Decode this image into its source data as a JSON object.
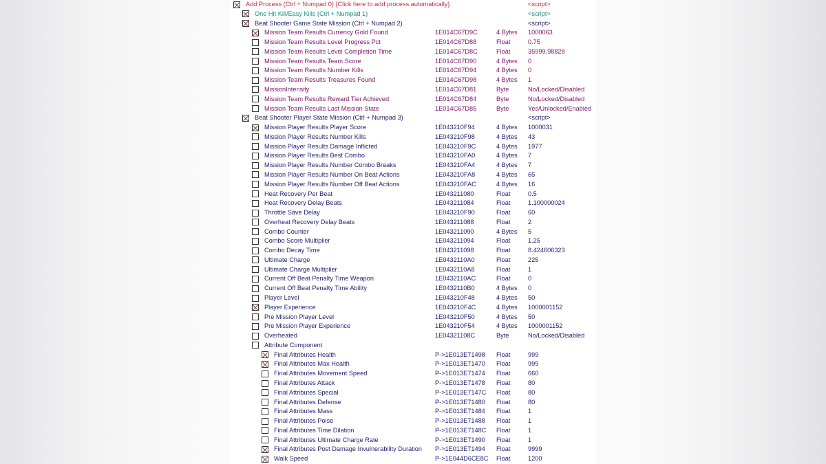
{
  "colors": {
    "red": "#c8283c",
    "teal": "#1f8c84",
    "navy": "#1e1e64",
    "purple": "#7a1468",
    "blue": "#23236e"
  },
  "rows": [
    {
      "level": 0,
      "checked": true,
      "color": "red",
      "desc": "Add Process (Ctrl + Numpad 0) {Click here to add process automatically}",
      "address": "",
      "type": "",
      "value": "<script>"
    },
    {
      "level": 1,
      "checked": true,
      "color": "teal",
      "desc": "One Hit Kill/Easy Kills (Ctrl + Numpad 1)",
      "address": "",
      "type": "",
      "value": "<script>"
    },
    {
      "level": 1,
      "checked": true,
      "color": "navy",
      "desc": "Beat Shooter Game State Mission (Ctrl + Numpad 2)",
      "address": "",
      "type": "",
      "value": "<script>"
    },
    {
      "level": 2,
      "checked": true,
      "color": "purple",
      "desc": "Mission Team Results Currency Gold Found",
      "address": "1E014C67D9C",
      "type": "4 Bytes",
      "value": "1000063"
    },
    {
      "level": 2,
      "checked": false,
      "color": "purple",
      "desc": "Mission Team Results Level Progress Pct",
      "address": "1E014C67D88",
      "type": "Float",
      "value": "0.75"
    },
    {
      "level": 2,
      "checked": false,
      "color": "purple",
      "desc": "Mission Team Results Level Completion Time",
      "address": "1E014C67D8C",
      "type": "Float",
      "value": "35999.98828"
    },
    {
      "level": 2,
      "checked": false,
      "color": "purple",
      "desc": "Mission Team Results Team Score",
      "address": "1E014C67D90",
      "type": "4 Bytes",
      "value": "0"
    },
    {
      "level": 2,
      "checked": false,
      "color": "purple",
      "desc": "Mission Team Results Number Kills",
      "address": "1E014C67D94",
      "type": "4 Bytes",
      "value": "0"
    },
    {
      "level": 2,
      "checked": false,
      "color": "purple",
      "desc": "Mission Team Results Treasures Found",
      "address": "1E014C67D98",
      "type": "4 Bytes",
      "value": "1"
    },
    {
      "level": 2,
      "checked": false,
      "color": "purple",
      "desc": "MissionIntensity",
      "address": "1E014C67D81",
      "type": "Byte",
      "value": "No/Locked/Disabled"
    },
    {
      "level": 2,
      "checked": false,
      "color": "purple",
      "desc": "Mission Team Results Reward Tier Achieved",
      "address": "1E014C67D84",
      "type": "Byte",
      "value": "No/Locked/Disabled"
    },
    {
      "level": 2,
      "checked": false,
      "color": "purple",
      "desc": "Mission Team Results Last Mission State",
      "address": "1E014C67D85",
      "type": "Byte",
      "value": "Yes/Unlocked/Enabled"
    },
    {
      "level": 1,
      "checked": true,
      "color": "navy",
      "desc": "Beat Shooter Player State Mission (Ctrl + Numpad 3)",
      "address": "",
      "type": "",
      "value": "<script>"
    },
    {
      "level": 2,
      "checked": true,
      "color": "blue",
      "desc": "Mission Player Results Player Score",
      "address": "1E043210F94",
      "type": "4 Bytes",
      "value": "1000031"
    },
    {
      "level": 2,
      "checked": false,
      "color": "blue",
      "desc": "Mission Player Results Number Kills",
      "address": "1E043210F98",
      "type": "4 Bytes",
      "value": "43"
    },
    {
      "level": 2,
      "checked": false,
      "color": "blue",
      "desc": "Mission Player Results Damage Inflicted",
      "address": "1E043210F9C",
      "type": "4 Bytes",
      "value": "1977"
    },
    {
      "level": 2,
      "checked": false,
      "color": "blue",
      "desc": "Mission Player Results Best Combo",
      "address": "1E043210FA0",
      "type": "4 Bytes",
      "value": "7"
    },
    {
      "level": 2,
      "checked": false,
      "color": "blue",
      "desc": "Mission Player Results Number Combo Breaks",
      "address": "1E043210FA4",
      "type": "4 Bytes",
      "value": "7"
    },
    {
      "level": 2,
      "checked": false,
      "color": "blue",
      "desc": "Mission Player Results Number On Beat Actions",
      "address": "1E043210FA8",
      "type": "4 Bytes",
      "value": "65"
    },
    {
      "level": 2,
      "checked": false,
      "color": "blue",
      "desc": "Mission Player Results Number Off Beat Actions",
      "address": "1E043210FAC",
      "type": "4 Bytes",
      "value": "16"
    },
    {
      "level": 2,
      "checked": false,
      "color": "blue",
      "desc": "Heat Recovery Per Beat",
      "address": "1E043211080",
      "type": "Float",
      "value": "0.5"
    },
    {
      "level": 2,
      "checked": false,
      "color": "blue",
      "desc": "Heat Recovery Delay Beats",
      "address": "1E043211084",
      "type": "Float",
      "value": "1.100000024"
    },
    {
      "level": 2,
      "checked": false,
      "color": "blue",
      "desc": "Throttle Save Delay",
      "address": "1E043210F90",
      "type": "Float",
      "value": "60"
    },
    {
      "level": 2,
      "checked": false,
      "color": "blue",
      "desc": "Overheat Recovery Delay Beats",
      "address": "1E043211088",
      "type": "Float",
      "value": "2"
    },
    {
      "level": 2,
      "checked": false,
      "color": "blue",
      "desc": "Combo Counter",
      "address": "1E043211090",
      "type": "4 Bytes",
      "value": "5"
    },
    {
      "level": 2,
      "checked": false,
      "color": "blue",
      "desc": "Combo Score Multiplier",
      "address": "1E043211094",
      "type": "Float",
      "value": "1.25"
    },
    {
      "level": 2,
      "checked": false,
      "color": "blue",
      "desc": "Combo Decay Time",
      "address": "1E043211098",
      "type": "Float",
      "value": "8.424606323"
    },
    {
      "level": 2,
      "checked": false,
      "color": "blue",
      "desc": "Ultimate Charge",
      "address": "1E0432110A0",
      "type": "Float",
      "value": "225"
    },
    {
      "level": 2,
      "checked": false,
      "color": "blue",
      "desc": "Ultimate Charge Multiplier",
      "address": "1E0432110A8",
      "type": "Float",
      "value": "1"
    },
    {
      "level": 2,
      "checked": false,
      "color": "blue",
      "desc": "Current Off Beat Penalty Time Weapon",
      "address": "1E0432110AC",
      "type": "Float",
      "value": "0"
    },
    {
      "level": 2,
      "checked": false,
      "color": "blue",
      "desc": "Current Off Beat Penalty Time Ability",
      "address": "1E0432110B0",
      "type": "4 Bytes",
      "value": "0"
    },
    {
      "level": 2,
      "checked": false,
      "color": "blue",
      "desc": "Player Level",
      "address": "1E043210F48",
      "type": "4 Bytes",
      "value": "50"
    },
    {
      "level": 2,
      "checked": true,
      "color": "blue",
      "desc": "Player Experience",
      "address": "1E043210F4C",
      "type": "4 Bytes",
      "value": "1000001152"
    },
    {
      "level": 2,
      "checked": false,
      "color": "blue",
      "desc": "Pre Mission Player Level",
      "address": "1E043210F50",
      "type": "4 Bytes",
      "value": "50"
    },
    {
      "level": 2,
      "checked": false,
      "color": "blue",
      "desc": "Pre Mission Player Experience",
      "address": "1E043210F54",
      "type": "4 Bytes",
      "value": "1000001152"
    },
    {
      "level": 2,
      "checked": false,
      "color": "blue",
      "desc": "Overheated",
      "address": "1E04321108C",
      "type": "Byte",
      "value": "No/Locked/Disabled"
    },
    {
      "level": 2,
      "checked": false,
      "color": "navy",
      "desc": "Attribute Component",
      "address": "",
      "type": "",
      "value": ""
    },
    {
      "level": 3,
      "checked": true,
      "color": "blue",
      "desc": "Final Attributes Health",
      "address": "P->1E013E71498",
      "type": "Float",
      "value": "999"
    },
    {
      "level": 3,
      "checked": true,
      "color": "blue",
      "desc": "Final Attributes Max Health",
      "address": "P->1E013E71470",
      "type": "Float",
      "value": "999"
    },
    {
      "level": 3,
      "checked": false,
      "color": "blue",
      "desc": "Final Attributes Movement Speed",
      "address": "P->1E013E71474",
      "type": "Float",
      "value": "660"
    },
    {
      "level": 3,
      "checked": false,
      "color": "blue",
      "desc": "Final Attributes Attack",
      "address": "P->1E013E71478",
      "type": "Float",
      "value": "80"
    },
    {
      "level": 3,
      "checked": false,
      "color": "blue",
      "desc": "Final Attributes Special",
      "address": "P->1E013E7147C",
      "type": "Float",
      "value": "80"
    },
    {
      "level": 3,
      "checked": false,
      "color": "blue",
      "desc": "Final Attributes Defense",
      "address": "P->1E013E71480",
      "type": "Float",
      "value": "80"
    },
    {
      "level": 3,
      "checked": false,
      "color": "blue",
      "desc": "Final Attributes Mass",
      "address": "P->1E013E71484",
      "type": "Float",
      "value": "1"
    },
    {
      "level": 3,
      "checked": false,
      "color": "blue",
      "desc": "Final Attributes Poise",
      "address": "P->1E013E71488",
      "type": "Float",
      "value": "1"
    },
    {
      "level": 3,
      "checked": false,
      "color": "blue",
      "desc": "Final Attributes Time Dilation",
      "address": "P->1E013E7148C",
      "type": "Float",
      "value": "1"
    },
    {
      "level": 3,
      "checked": false,
      "color": "blue",
      "desc": "Final Attributes Ultimate Charge Rate",
      "address": "P->1E013E71490",
      "type": "Float",
      "value": "1"
    },
    {
      "level": 3,
      "checked": true,
      "color": "blue",
      "desc": "Final Attributes Post Damage Invulnerability Duration",
      "address": "P->1E013E71494",
      "type": "Float",
      "value": "9999"
    },
    {
      "level": 3,
      "checked": true,
      "color": "blue",
      "desc": "Walk Speed",
      "address": "P->1E044D6CE8C",
      "type": "Float",
      "value": "1200"
    }
  ]
}
